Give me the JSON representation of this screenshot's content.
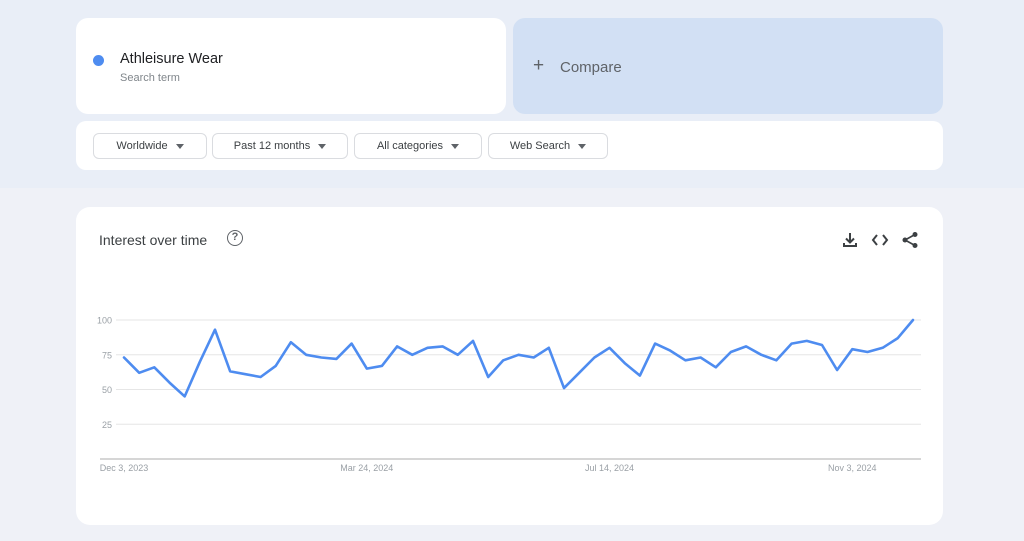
{
  "search_term": {
    "name": "Athleisure Wear",
    "subtitle": "Search term",
    "color": "#4e8cf0"
  },
  "compare": {
    "icon": "plus-icon",
    "label": "Compare"
  },
  "filters": [
    {
      "label": "Worldwide",
      "icon": "dropdown-caret-icon"
    },
    {
      "label": "Past 12 months",
      "icon": "dropdown-caret-icon"
    },
    {
      "label": "All categories",
      "icon": "dropdown-caret-icon"
    },
    {
      "label": "Web Search",
      "icon": "dropdown-caret-icon"
    }
  ],
  "chart_section": {
    "title": "Interest over time",
    "help_icon": "help-circle-icon",
    "help_symbol": "?",
    "actions": [
      {
        "name": "download-icon"
      },
      {
        "name": "embed-code-icon"
      },
      {
        "name": "share-icon"
      }
    ]
  },
  "chart_data": {
    "type": "line",
    "title": "Interest over time",
    "xlabel": "",
    "ylabel": "",
    "ylim": [
      0,
      100
    ],
    "yticks": [
      25,
      50,
      75,
      100
    ],
    "ytick_labels": [
      "25",
      "50",
      "75",
      "100"
    ],
    "xtick_labels": [
      {
        "label": "Dec 3, 2023",
        "index": 0
      },
      {
        "label": "Mar 24, 2024",
        "index": 16
      },
      {
        "label": "Jul 14, 2024",
        "index": 32
      },
      {
        "label": "Nov 3, 2024",
        "index": 48
      }
    ],
    "grid": true,
    "legend": "none",
    "series": [
      {
        "name": "Athleisure Wear",
        "color": "#4e8cf0",
        "values": [
          73,
          62,
          66,
          55,
          45,
          70,
          93,
          63,
          61,
          59,
          67,
          84,
          75,
          73,
          72,
          83,
          65,
          67,
          81,
          75,
          80,
          81,
          75,
          85,
          59,
          71,
          75,
          73,
          80,
          51,
          62,
          73,
          80,
          69,
          60,
          83,
          78,
          71,
          73,
          66,
          77,
          81,
          75,
          71,
          83,
          85,
          82,
          64,
          79,
          77,
          80,
          87,
          100
        ]
      }
    ]
  }
}
